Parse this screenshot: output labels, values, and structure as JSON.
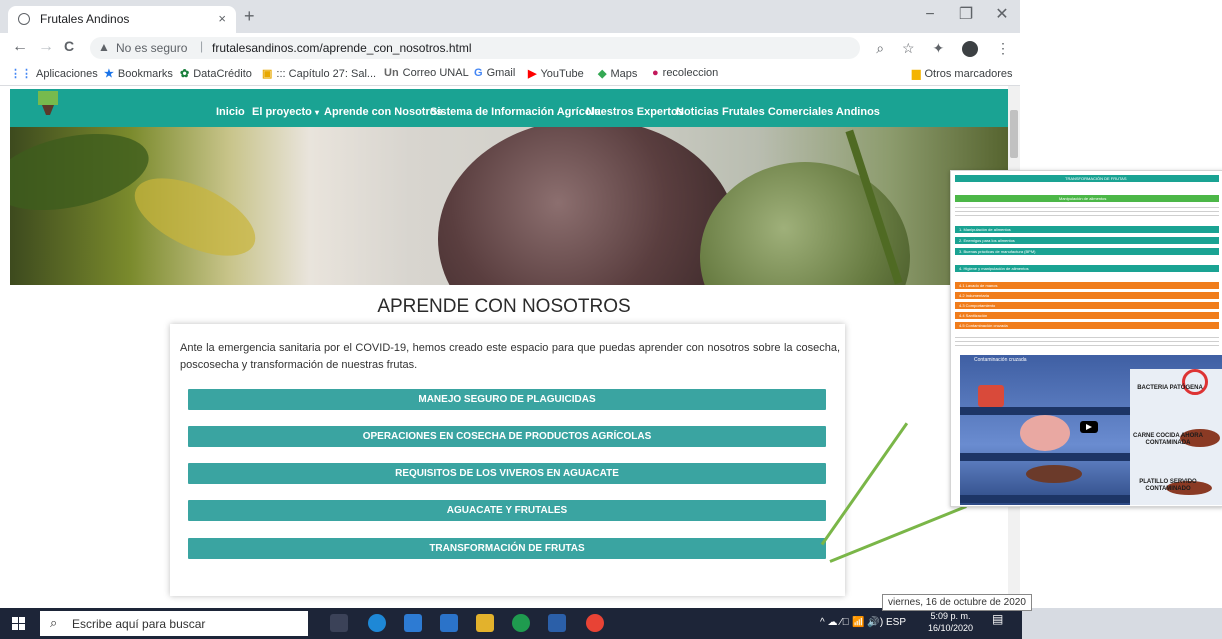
{
  "browser": {
    "tab_title": "Frutales Andinos",
    "tab_close": "×",
    "new_tab": "+",
    "window_controls": [
      "−",
      "❐",
      "✕"
    ],
    "nav": {
      "back": "←",
      "forward": "→",
      "reload": "C"
    },
    "security_text": "No es seguro",
    "url": "frutalesandinos.com/aprende_con_nosotros.html",
    "toolbar_icons": [
      "search-icon",
      "star-icon",
      "extensions-icon",
      "avatar-icon",
      "menu-icon"
    ]
  },
  "bookmarks": [
    {
      "label": "Aplicaciones",
      "icon": "apps-icon"
    },
    {
      "label": "Bookmarks",
      "icon": "star-icon"
    },
    {
      "label": "DataCrédito",
      "icon": "datacredito-icon"
    },
    {
      "label": "::: Capítulo 27: Sal...",
      "icon": "doc-icon"
    },
    {
      "label": "Correo UNAL",
      "icon": "un-icon"
    },
    {
      "label": "Gmail",
      "icon": "google-icon"
    },
    {
      "label": "YouTube",
      "icon": "youtube-icon"
    },
    {
      "label": "Maps",
      "icon": "maps-icon"
    },
    {
      "label": "recoleccion",
      "icon": "bookmark-icon"
    }
  ],
  "bookmarks_other": "Otros marcadores",
  "site": {
    "nav": [
      "Inicio",
      "El proyecto",
      "Aprende con Nosotros",
      "Sistema de Información Agrícola",
      "Nuestros Expertos",
      "Noticias",
      "Frutales Comerciales Andinos"
    ],
    "heading": "APRENDE CON NOSOTROS",
    "intro": "Ante la emergencia sanitaria por el COVID-19, hemos creado este espacio para que puedas aprender con nosotros sobre la cosecha, poscosecha y transformación de nuestras frutas.",
    "buttons": [
      "MANEJO SEGURO DE PLAGUICIDAS",
      "OPERACIONES EN COSECHA DE PRODUCTOS AGRÍCOLAS",
      "REQUISITOS DE LOS VIVEROS EN AGUACATE",
      "AGUACATE Y FRUTALES",
      "TRANSFORMACIÓN DE FRUTAS"
    ],
    "accent": "#1aa393",
    "button_color": "#3aa4a1"
  },
  "callout": {
    "header": "TRANSFORMACIÓN DE FRUTAS",
    "subheader": "Manipulación de alimentos",
    "teal_items": [
      "1. Manipulación de alimentos",
      "2. Enemigos para los alimentos",
      "3. Buenas prácticas de manufactura (BPM)",
      "4. Higiene y manipulación de alimentos"
    ],
    "orange_items": [
      "4.1 Lavado de manos",
      "4.2 Indumentaria",
      "4.3 Comportamiento",
      "4.4 Sanitización",
      "4.5 Contaminación cruzada"
    ],
    "video_title": "Contaminación cruzada",
    "video_labels": [
      "BACTERIA PATÓGENA",
      "CARNE COCIDA AHORA CONTAMINADA",
      "PLATILLO SERVIDO CONTAMINADO"
    ],
    "teal": "#1aa393",
    "orange": "#f07d1c",
    "green": "#4cb748"
  },
  "taskbar": {
    "search_placeholder": "Escribe aquí para buscar",
    "tray": "^ ☁ ⁄ﾞ 📶 🔊) ESP",
    "time": "5:09 p. m.",
    "date": "16/10/2020",
    "tooltip": "viernes, 16 de octubre de 2020"
  }
}
